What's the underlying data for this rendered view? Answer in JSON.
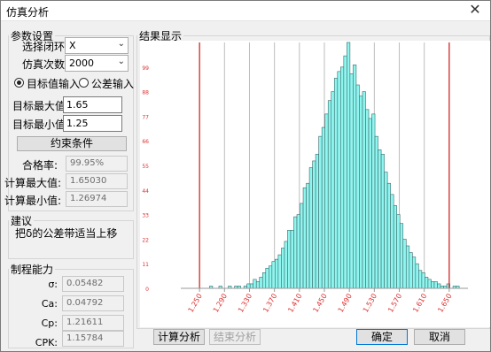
{
  "window": {
    "title": "仿真分析",
    "close_glyph": "✕"
  },
  "params": {
    "legend": "参数设置",
    "loop_label": "选择闭环:",
    "loop_value": "X",
    "count_label": "仿真次数:",
    "count_value": "2000",
    "radio_target": "目标值输入",
    "radio_tolerance": "公差输入",
    "target_max_label": "目标最大值:",
    "target_max_value": "1.65",
    "target_min_label": "目标最小值:",
    "target_min_value": "1.25",
    "constraint_button": "约束条件",
    "pass_rate_label": "合格率:",
    "pass_rate_value": "99.95%",
    "calc_max_label": "计算最大值:",
    "calc_max_value": "1.65030",
    "calc_min_label": "计算最小值:",
    "calc_min_value": "1.26974"
  },
  "advice": {
    "legend": "建议",
    "text": "把δ的公差带适当上移"
  },
  "capability": {
    "legend": "制程能力",
    "rows": [
      {
        "label": "σ:",
        "value": "0.05482"
      },
      {
        "label": "Ca:",
        "value": "0.04792"
      },
      {
        "label": "Cp:",
        "value": "1.21611"
      },
      {
        "label": "CPK:",
        "value": "1.15784"
      }
    ]
  },
  "result": {
    "legend": "结果显示"
  },
  "buttons": {
    "calc": "计算分析",
    "end": "结束分析",
    "ok": "确定",
    "cancel": "取消"
  },
  "colors": {
    "bar_fill": "#8ff5ef",
    "bar_stroke": "#3a6a6a",
    "limit_line": "#d21a1a",
    "tick_label": "#e03030",
    "grid": "#bdbdbd"
  },
  "chart_data": {
    "type": "bar",
    "title": "",
    "xlabel": "",
    "ylabel": "",
    "y_tick_labels": [
      "0",
      "11",
      "22",
      "33",
      "44",
      "55",
      "66",
      "77",
      "88",
      "99"
    ],
    "ylim": [
      0,
      110
    ],
    "xlim": [
      1.22,
      1.68
    ],
    "x_tick_labels": [
      "1.250",
      "1.290",
      "1.330",
      "1.370",
      "1.410",
      "1.450",
      "1.490",
      "1.530",
      "1.570",
      "1.610",
      "1.650"
    ],
    "limits": {
      "lower": 1.25,
      "upper": 1.65
    },
    "bin_start": 1.266,
    "bin_width": 0.005,
    "values": [
      1,
      0,
      0,
      1,
      0,
      0,
      1,
      0,
      1,
      1,
      0,
      1,
      2,
      2,
      4,
      3,
      5,
      7,
      9,
      10,
      12,
      13,
      15,
      18,
      21,
      26,
      26,
      32,
      33,
      38,
      45,
      47,
      54,
      57,
      60,
      68,
      72,
      78,
      84,
      88,
      94,
      97,
      99,
      104,
      110,
      96,
      100,
      91,
      86,
      88,
      80,
      76,
      78,
      68,
      62,
      60,
      52,
      47,
      42,
      37,
      33,
      29,
      22,
      19,
      16,
      14,
      11,
      8,
      7,
      5,
      4,
      3,
      3,
      2,
      1,
      1,
      2,
      0,
      1,
      1
    ]
  }
}
